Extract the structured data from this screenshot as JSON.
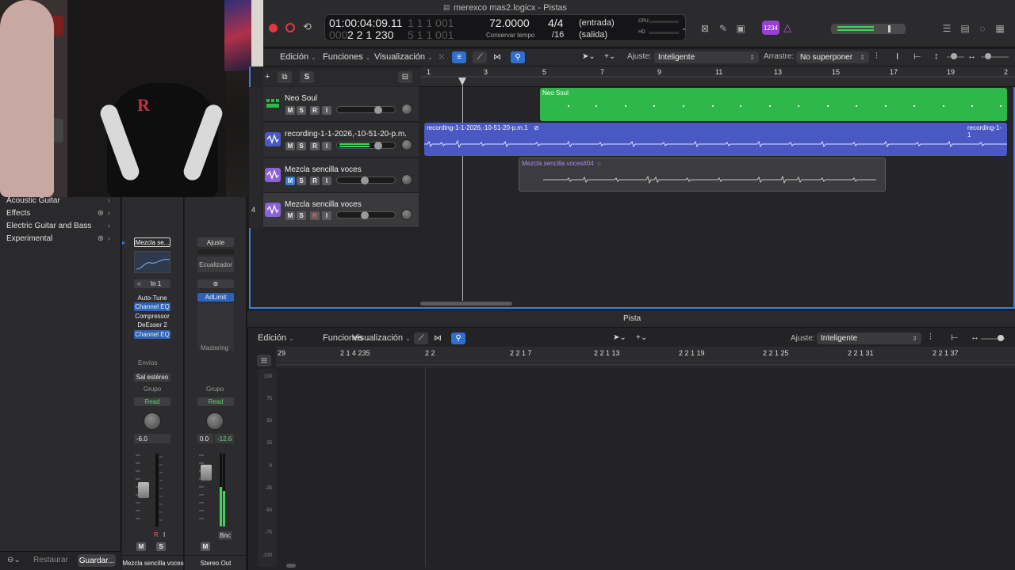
{
  "window": {
    "title": "merexco mas2.logicx - Pistas"
  },
  "lcd": {
    "position_time": "01:00:04:09.11",
    "position_bars": "2  2  1  230",
    "position_time_ghost": "1  1  1  001",
    "position_bars_ghost": "5  1  1  001",
    "tempo": "72.0000",
    "tempo_label": "Conservar tempo",
    "signature": "4/4",
    "division": "/16",
    "input_label": "(entrada)",
    "output_label": "(salida)",
    "cpu_label": "CPU",
    "hd_label": "HD"
  },
  "badge": "1234",
  "arrange_toolbar": {
    "edit": "Edición",
    "functions": "Funciones",
    "view": "Visualización",
    "snap_label": "Ajuste:",
    "snap_value": "Inteligente",
    "drag_label": "Arrastre:",
    "drag_value": "No superponer"
  },
  "track_header_top": {
    "s_label": "S"
  },
  "tracks": [
    {
      "name": "Neo Soul",
      "color": "#2fb84a",
      "m": "M",
      "s": "S",
      "r": "R",
      "i": "I",
      "number": ""
    },
    {
      "name": "recording-1-1-2026,-10-51-20-p.m.",
      "color": "#5563c9",
      "m": "M",
      "s": "S",
      "r": "R",
      "i": "I",
      "number": ""
    },
    {
      "name": "Mezcla sencilla voces",
      "color": "#8a62d6",
      "m": "M",
      "s": "S",
      "r": "R",
      "i": "I",
      "number": ""
    },
    {
      "name": "Mezcla sencilla voces",
      "color": "#8a62d6",
      "m": "M",
      "s": "S",
      "r": "R",
      "i": "I",
      "number": "4"
    }
  ],
  "ruler_bars": [
    "1",
    "3",
    "5",
    "7",
    "9",
    "11",
    "13",
    "15",
    "17",
    "19",
    "2"
  ],
  "regions": {
    "neo_soul": "Neo Soul",
    "recording_1": "recording-1-1-2026,-10-51-20-p.m.1",
    "recording_2": "recording-1-1",
    "mezcla": "Mezcla sencilla voces#04"
  },
  "library": {
    "items": [
      "Acoustic Guitar",
      "Effects",
      "Electric Guitar and Bass",
      "Experimental"
    ],
    "restore": "Restaurar",
    "save": "Guardar..."
  },
  "strip1": {
    "setting": "Mezcla se...",
    "input": "In 1",
    "plugins": [
      "Auto-Tune",
      "Channel EQ",
      "Compressor",
      "DeEsser 2",
      "Channel EQ"
    ],
    "sends": "Envíos",
    "output": "Sal estéreo",
    "group": "Grupo",
    "automation": "Read",
    "volume": "-6.0",
    "m": "M",
    "s": "S",
    "name": "Mezcla sencilla voces"
  },
  "strip2": {
    "setting": "Ajuste",
    "eq": "Ecualizador",
    "plugin": "AdLimit",
    "mastering": "Mastering",
    "group": "Grupo",
    "automation": "Read",
    "volume": "0.0",
    "peak": "-12.6",
    "m": "M",
    "bnc": "Bnc",
    "name": "Stereo Out"
  },
  "editor": {
    "title": "Pista",
    "edit": "Edición",
    "functions": "Funciones",
    "view": "Visualización",
    "snap_label": "Ajuste:",
    "snap_value": "Inteligente",
    "ruler": [
      "29",
      "2 1 4 235",
      "2 2",
      "2 2 1 7",
      "2 2 1 13",
      "2 2 1 19",
      "2 2 1 25",
      "2 2 1 31",
      "2 2 1 37"
    ],
    "scale": [
      "100",
      "75",
      "50",
      "25",
      "0",
      "-25",
      "-50",
      "-75",
      "-100"
    ]
  },
  "colors": {
    "accent_blue": "#3b7ee0",
    "region_green": "#2fb84a",
    "region_blue": "#4a58c4",
    "record_red": "#e0383e"
  }
}
